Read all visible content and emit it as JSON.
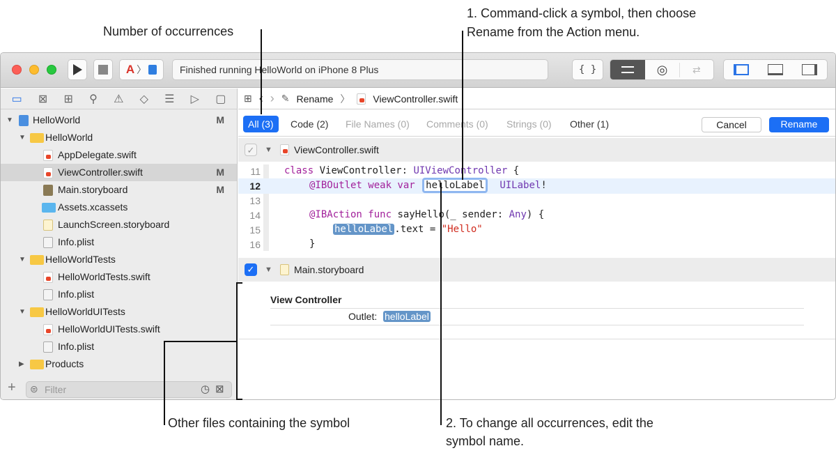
{
  "annotations": {
    "occurrences": "Number of occurrences",
    "step1_line1": "1. Command-click a symbol, then choose",
    "step1_line2": "Rename from the Action menu.",
    "other_files": "Other files containing the symbol",
    "step2_line1": "2. To change all occurrences, edit the",
    "step2_line2": "symbol name."
  },
  "toolbar": {
    "status": "Finished running HelloWorld on iPhone 8 Plus",
    "braces": "{ }"
  },
  "sidebar": {
    "items": [
      {
        "label": "HelloWorld",
        "badge": "M"
      },
      {
        "label": "HelloWorld"
      },
      {
        "label": "AppDelegate.swift"
      },
      {
        "label": "ViewController.swift",
        "badge": "M"
      },
      {
        "label": "Main.storyboard",
        "badge": "M"
      },
      {
        "label": "Assets.xcassets"
      },
      {
        "label": "LaunchScreen.storyboard"
      },
      {
        "label": "Info.plist"
      },
      {
        "label": "HelloWorldTests"
      },
      {
        "label": "HelloWorldTests.swift"
      },
      {
        "label": "Info.plist"
      },
      {
        "label": "HelloWorldUITests"
      },
      {
        "label": "HelloWorldUITests.swift"
      },
      {
        "label": "Info.plist"
      },
      {
        "label": "Products"
      }
    ],
    "filter_placeholder": "Filter"
  },
  "jumpbar": {
    "rename": "Rename",
    "file": "ViewController.swift"
  },
  "tabs": [
    "All (3)",
    "Code (2)",
    "File Names (0)",
    "Comments (0)",
    "Strings (0)",
    "Other (1)"
  ],
  "buttons": {
    "cancel": "Cancel",
    "rename": "Rename"
  },
  "sections": {
    "swift_file": "ViewController.swift",
    "storyboard_file": "Main.storyboard",
    "scene": "View Controller",
    "outlet_label": "Outlet:",
    "outlet_value": "helloLabel"
  },
  "code": {
    "line_numbers": [
      "11",
      "12",
      "13",
      "14",
      "15",
      "16"
    ],
    "l11_kw": "class",
    "l11_name": " ViewController: ",
    "l11_type": "UIViewController",
    "l11_end": " {",
    "l12_kw": "@IBOutlet weak var",
    "l12_sym": "helloLabel",
    "l12_type": "UILabel",
    "l12_end": "!",
    "l14_kw": "@IBAction func",
    "l14_mid": " sayHello(_ sender: ",
    "l14_type": "Any",
    "l14_end": ") {",
    "l15_sym": "helloLabel",
    "l15_mid": ".text = ",
    "l15_str": "\"Hello\"",
    "l16": "}"
  }
}
